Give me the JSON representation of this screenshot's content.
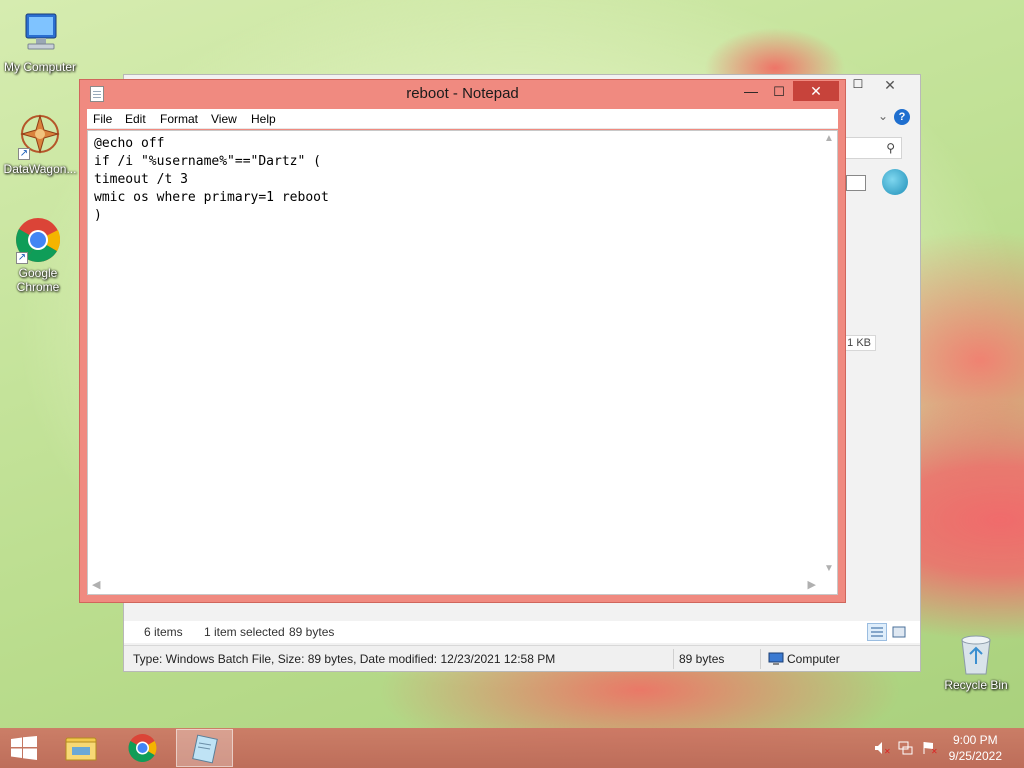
{
  "desktop": {
    "icons": [
      {
        "label": "My Computer"
      },
      {
        "label": "DataWagon..."
      },
      {
        "label": "Google Chrome"
      }
    ],
    "recycle_bin": {
      "label": "Recycle Bin"
    }
  },
  "explorer": {
    "size_cell": "1 KB",
    "status": {
      "items": "6 items",
      "selected": "1 item selected",
      "selected_size": "89 bytes"
    },
    "details": {
      "info": "Type: Windows Batch File, Size: 89 bytes, Date modified: 12/23/2021 12:58 PM",
      "size": "89 bytes",
      "location": "Computer"
    }
  },
  "notepad": {
    "title": "reboot - Notepad",
    "menu": [
      "File",
      "Edit",
      "Format",
      "View",
      "Help"
    ],
    "content": "@echo off\nif /i \"%username%\"==\"Dartz\" (\ntimeout /t 3\nwmic os where primary=1 reboot\n)"
  },
  "taskbar": {
    "clock": {
      "time": "9:00 PM",
      "date": "9/25/2022"
    }
  },
  "colors": {
    "notepad_frame": "#f08a80",
    "close_button": "#c7433b",
    "taskbar": "#c8715f",
    "help_blue": "#1f6fcf"
  }
}
